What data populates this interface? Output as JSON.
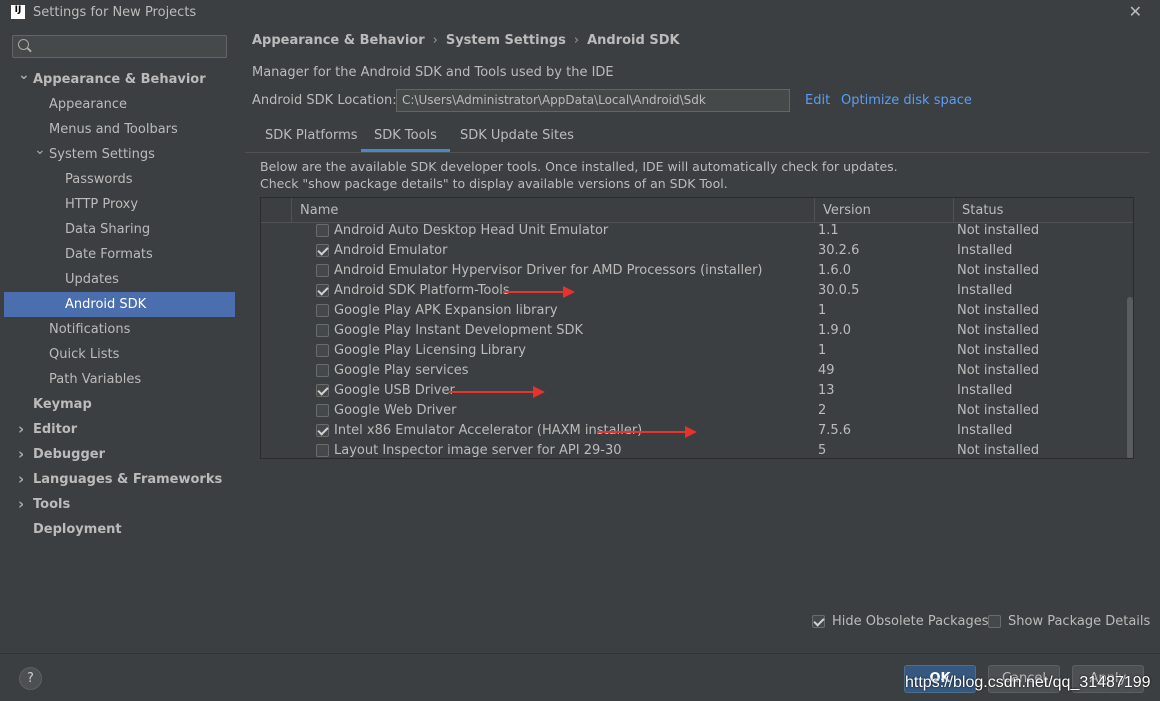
{
  "window": {
    "title": "Settings for New Projects",
    "app_icon_text": "IJ"
  },
  "sidebar": {
    "search": {
      "value": "",
      "placeholder": ""
    },
    "items": [
      {
        "label": "Appearance & Behavior",
        "level": 0,
        "bold": true,
        "expanded": true
      },
      {
        "label": "Appearance",
        "level": 1
      },
      {
        "label": "Menus and Toolbars",
        "level": 1
      },
      {
        "label": "System Settings",
        "level": 1,
        "expanded": true
      },
      {
        "label": "Passwords",
        "level": 2
      },
      {
        "label": "HTTP Proxy",
        "level": 2
      },
      {
        "label": "Data Sharing",
        "level": 2
      },
      {
        "label": "Date Formats",
        "level": 2
      },
      {
        "label": "Updates",
        "level": 2
      },
      {
        "label": "Android SDK",
        "level": 2,
        "selected": true
      },
      {
        "label": "Notifications",
        "level": 1
      },
      {
        "label": "Quick Lists",
        "level": 1
      },
      {
        "label": "Path Variables",
        "level": 1
      },
      {
        "label": "Keymap",
        "level": 0,
        "bold": true
      },
      {
        "label": "Editor",
        "level": 0,
        "bold": true,
        "collapsed": true
      },
      {
        "label": "Debugger",
        "level": 0,
        "bold": true,
        "collapsed": true
      },
      {
        "label": "Languages & Frameworks",
        "level": 0,
        "bold": true,
        "collapsed": true
      },
      {
        "label": "Tools",
        "level": 0,
        "bold": true,
        "collapsed": true
      },
      {
        "label": "Deployment",
        "level": 0,
        "bold": true
      }
    ]
  },
  "breadcrumb": [
    "Appearance & Behavior",
    "System Settings",
    "Android SDK"
  ],
  "main": {
    "description": "Manager for the Android SDK and Tools used by the IDE",
    "sdk_location_label": "Android SDK Location:",
    "sdk_location_value": "C:\\Users\\Administrator\\AppData\\Local\\Android\\Sdk",
    "edit_link": "Edit",
    "optimize_link": "Optimize disk space",
    "tabs": [
      {
        "label": "SDK Platforms",
        "active": false
      },
      {
        "label": "SDK Tools",
        "active": true
      },
      {
        "label": "SDK Update Sites",
        "active": false
      }
    ],
    "info_line1": "Below are the available SDK developer tools. Once installed, IDE will automatically check for updates.",
    "info_line2": "Check \"show package details\" to display available versions of an SDK Tool.",
    "table": {
      "columns": [
        "Name",
        "Version",
        "Status"
      ],
      "rows": [
        {
          "checked": false,
          "name": "Android Auto Desktop Head Unit Emulator",
          "version": "1.1",
          "status": "Not installed"
        },
        {
          "checked": true,
          "name": "Android Emulator",
          "version": "30.2.6",
          "status": "Installed"
        },
        {
          "checked": false,
          "name": "Android Emulator Hypervisor Driver for AMD Processors (installer)",
          "version": "1.6.0",
          "status": "Not installed"
        },
        {
          "checked": true,
          "name": "Android SDK Platform-Tools",
          "version": "30.0.5",
          "status": "Installed"
        },
        {
          "checked": false,
          "name": "Google Play APK Expansion library",
          "version": "1",
          "status": "Not installed"
        },
        {
          "checked": false,
          "name": "Google Play Instant Development SDK",
          "version": "1.9.0",
          "status": "Not installed"
        },
        {
          "checked": false,
          "name": "Google Play Licensing Library",
          "version": "1",
          "status": "Not installed"
        },
        {
          "checked": false,
          "name": "Google Play services",
          "version": "49",
          "status": "Not installed"
        },
        {
          "checked": true,
          "name": "Google USB Driver",
          "version": "13",
          "status": "Installed"
        },
        {
          "checked": false,
          "name": "Google Web Driver",
          "version": "2",
          "status": "Not installed"
        },
        {
          "checked": true,
          "name": "Intel x86 Emulator Accelerator (HAXM installer)",
          "version": "7.5.6",
          "status": "Installed"
        },
        {
          "checked": false,
          "name": "Layout Inspector image server for API 29-30",
          "version": "5",
          "status": "Not installed"
        }
      ]
    },
    "hide_obsolete": {
      "label": "Hide Obsolete Packages",
      "checked": true
    },
    "show_details": {
      "label": "Show Package Details",
      "checked": false
    }
  },
  "footer": {
    "help_label": "?",
    "ok_label": "OK",
    "cancel_label": "Cancel",
    "apply_label": "Apply",
    "watermark": "https://blog.csdn.net/qq_31487199"
  },
  "colors": {
    "accent": "#4b6eaf",
    "link": "#589df6",
    "annotation_arrow": "#e8322e",
    "background": "#3c3f41"
  }
}
